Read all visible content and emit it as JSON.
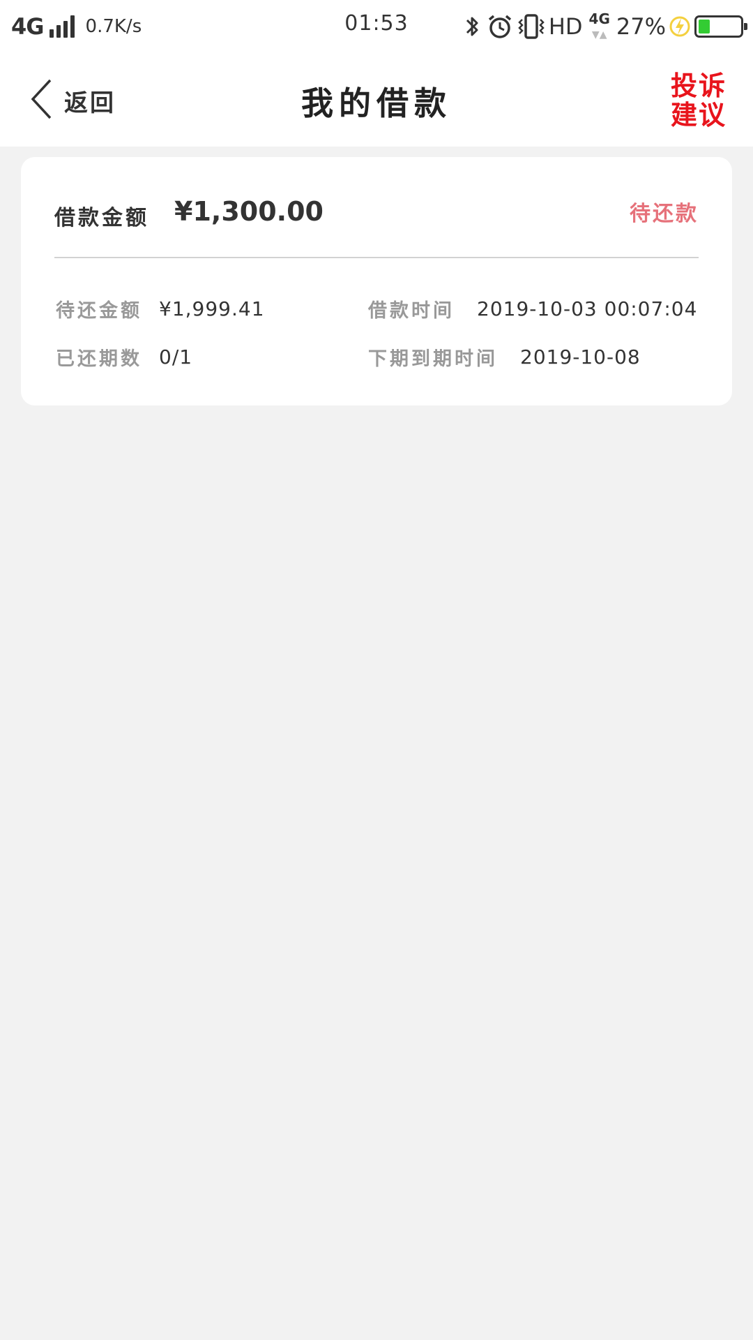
{
  "status_bar": {
    "network": "4G",
    "speed": "0.7K/s",
    "time": "01:53",
    "hd": "HD",
    "net_small": "4G",
    "battery_percent": "27%",
    "battery_level": 0.27,
    "icons": [
      "signal-icon",
      "bluetooth-icon",
      "alarm-icon",
      "vibrate-icon",
      "charging-icon",
      "battery-icon"
    ]
  },
  "nav": {
    "back_label": "返回",
    "title": "我的借款",
    "complaint_line1": "投诉",
    "complaint_line2": "建议"
  },
  "loan": {
    "amount_label": "借款金额",
    "amount_value": "¥1,300.00",
    "status": "待还款",
    "pending_label": "待还金额",
    "pending_value": "¥1,999.41",
    "loan_time_label": "借款时间",
    "loan_time_value": "2019-10-03 00:07:04",
    "periods_label": "已还期数",
    "periods_value": "0/1",
    "due_label": "下期到期时间",
    "due_value": "2019-10-08"
  },
  "colors": {
    "background": "#f2f2f2",
    "card": "#ffffff",
    "status_pink": "#e6717a",
    "complaint_red": "#e8141c",
    "battery_green": "#33cc33"
  }
}
